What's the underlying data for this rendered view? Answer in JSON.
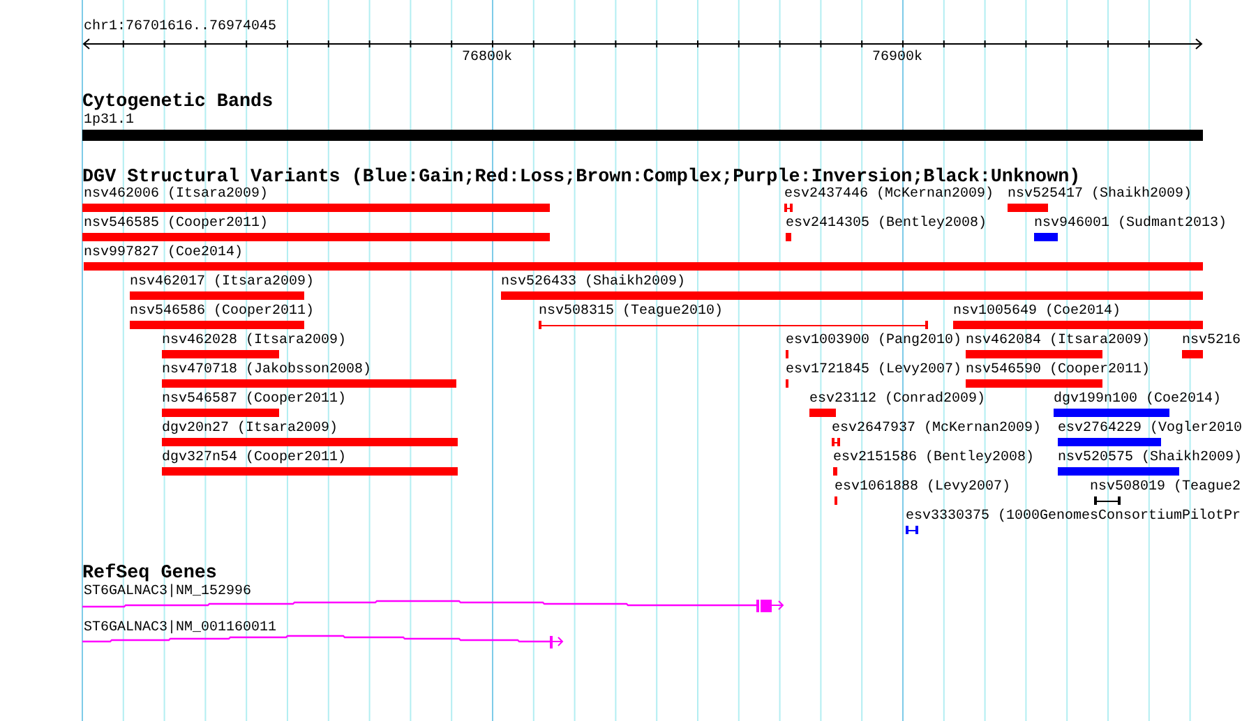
{
  "location": "chr1:76701616..76974045",
  "ruler": {
    "labels": [
      "76800k",
      "76900k"
    ]
  },
  "cytogenetic_bands": {
    "title": "Cytogenetic Bands",
    "band": "1p31.1"
  },
  "structural_variants": {
    "title": "DGV Structural Variants (Blue:Gain;Red:Loss;Brown:Complex;Purple:Inversion;Black:Unknown)",
    "features": [
      {
        "label": "nsv462006 (Itsara2009)",
        "color": "#ff0000",
        "kind": "bar"
      },
      {
        "label": "esv2437446 (McKernan2009)",
        "color": "#ff0000",
        "kind": "interval"
      },
      {
        "label": "nsv525417 (Shaikh2009)",
        "color": "#ff0000",
        "kind": "bar"
      },
      {
        "label": "nsv546585 (Cooper2011)",
        "color": "#ff0000",
        "kind": "bar"
      },
      {
        "label": "esv2414305 (Bentley2008)",
        "color": "#ff0000",
        "kind": "bar"
      },
      {
        "label": "nsv946001 (Sudmant2013)",
        "color": "#0000ff",
        "kind": "bar"
      },
      {
        "label": "nsv997827 (Coe2014)",
        "color": "#ff0000",
        "kind": "bar"
      },
      {
        "label": "nsv462017 (Itsara2009)",
        "color": "#ff0000",
        "kind": "bar"
      },
      {
        "label": "nsv526433 (Shaikh2009)",
        "color": "#ff0000",
        "kind": "bar"
      },
      {
        "label": "nsv546586 (Cooper2011)",
        "color": "#ff0000",
        "kind": "bar"
      },
      {
        "label": "nsv508315 (Teague2010)",
        "color": "#ff0000",
        "kind": "interval"
      },
      {
        "label": "nsv1005649 (Coe2014)",
        "color": "#ff0000",
        "kind": "bar"
      },
      {
        "label": "nsv462028 (Itsara2009)",
        "color": "#ff0000",
        "kind": "bar"
      },
      {
        "label": "esv1003900 (Pang2010)",
        "color": "#ff0000",
        "kind": "bar"
      },
      {
        "label": "nsv462084 (Itsara2009)",
        "color": "#ff0000",
        "kind": "bar"
      },
      {
        "label": "nsv5216",
        "color": "#ff0000",
        "kind": "bar"
      },
      {
        "label": "nsv470718 (Jakobsson2008)",
        "color": "#ff0000",
        "kind": "bar"
      },
      {
        "label": "esv1721845 (Levy2007)",
        "color": "#ff0000",
        "kind": "bar"
      },
      {
        "label": "nsv546590 (Cooper2011)",
        "color": "#ff0000",
        "kind": "bar"
      },
      {
        "label": "nsv546587 (Cooper2011)",
        "color": "#ff0000",
        "kind": "bar"
      },
      {
        "label": "esv23112 (Conrad2009)",
        "color": "#ff0000",
        "kind": "bar"
      },
      {
        "label": "dgv199n100 (Coe2014)",
        "color": "#0000ff",
        "kind": "bar"
      },
      {
        "label": "dgv20n27 (Itsara2009)",
        "color": "#ff0000",
        "kind": "bar"
      },
      {
        "label": "esv2647937 (McKernan2009)",
        "color": "#ff0000",
        "kind": "interval"
      },
      {
        "label": "esv2764229 (Vogler2010",
        "color": "#0000ff",
        "kind": "bar"
      },
      {
        "label": "dgv327n54 (Cooper2011)",
        "color": "#ff0000",
        "kind": "bar"
      },
      {
        "label": "esv2151586 (Bentley2008)",
        "color": "#ff0000",
        "kind": "bar"
      },
      {
        "label": "nsv520575 (Shaikh2009)",
        "color": "#0000ff",
        "kind": "bar"
      },
      {
        "label": "esv1061888 (Levy2007)",
        "color": "#ff0000",
        "kind": "bar"
      },
      {
        "label": "nsv508019 (Teague2",
        "color": "#000000",
        "kind": "interval"
      },
      {
        "label": "esv3330375 (1000GenomesConsortiumPilotPr",
        "color": "#0000ff",
        "kind": "interval"
      }
    ]
  },
  "refseq_genes": {
    "title": "RefSeq Genes",
    "genes": [
      {
        "label": "ST6GALNAC3|NM_152996"
      },
      {
        "label": "ST6GALNAC3|NM_001160011"
      }
    ]
  }
}
